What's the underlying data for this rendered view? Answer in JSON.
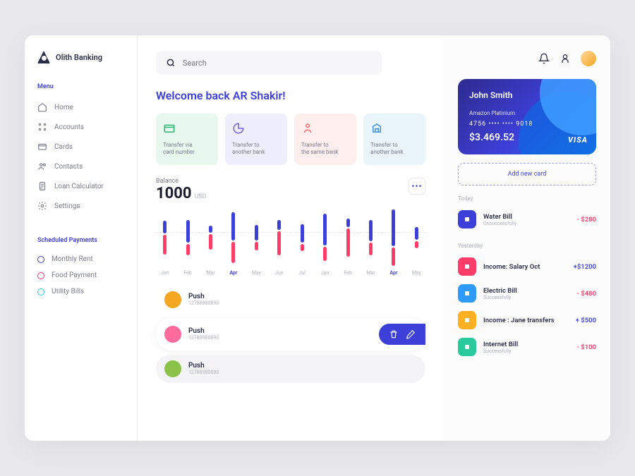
{
  "logo": {
    "text": "Olith Banking"
  },
  "sidebar": {
    "menu_title": "Menu",
    "items": [
      {
        "label": "Home"
      },
      {
        "label": "Accounts"
      },
      {
        "label": "Cards"
      },
      {
        "label": "Contacts"
      },
      {
        "label": "Loan Calculator"
      },
      {
        "label": "Settings"
      }
    ],
    "scheduled_title": "Scheduled Payments",
    "scheduled": [
      {
        "label": "Monthly Rent",
        "color": "#3d3fd9"
      },
      {
        "label": "Food Payment",
        "color": "#ff3d68"
      },
      {
        "label": "Utility Bills",
        "color": "#2fd0e6"
      }
    ]
  },
  "search": {
    "placeholder": "Search"
  },
  "welcome": "Welcome back AR Shakir!",
  "actions": [
    {
      "label": "Transfer via\ncard number",
      "bg": "#e8f8ee",
      "icon": "#2bb673"
    },
    {
      "label": "Transfer to\nanother bank",
      "bg": "#efeefc",
      "icon": "#6b5fe0"
    },
    {
      "label": "Transfer to\nthe same bank",
      "bg": "#feefee",
      "icon": "#ff6b6b"
    },
    {
      "label": "Transfer to\nanother bank",
      "bg": "#e9f5fb",
      "icon": "#3d8fe0"
    }
  ],
  "balance": {
    "label": "Balance",
    "value": "1000",
    "currency": "USD"
  },
  "chart_data": {
    "type": "bar",
    "categories": [
      "Jan",
      "Feb",
      "Mar",
      "Apr",
      "May",
      "Jun",
      "Jul",
      "Jan",
      "Feb",
      "Mar",
      "Apr",
      "May"
    ],
    "active_index": [
      3,
      10
    ],
    "series": [
      {
        "name": "blue",
        "color": "#3d3fd9",
        "values": [
          18,
          32,
          10,
          40,
          22,
          14,
          26,
          45,
          12,
          30,
          52,
          18
        ]
      },
      {
        "name": "red",
        "color": "#ff3d68",
        "values": [
          28,
          16,
          22,
          30,
          12,
          34,
          10,
          20,
          40,
          18,
          26,
          10
        ]
      }
    ]
  },
  "push": [
    {
      "name": "Push",
      "sub": "12788980890",
      "actions": false
    },
    {
      "name": "Push",
      "sub": "12788980890",
      "actions": true
    },
    {
      "name": "Push",
      "sub": "12788980890",
      "actions": false,
      "dark": true
    }
  ],
  "card": {
    "name": "John Smith",
    "plan": "Amazon Platinium",
    "number": "4756   ••••   ••••   9018",
    "balance": "$3.469.52",
    "brand": "VISA"
  },
  "add_card": "Add new card",
  "transactions": {
    "groups": [
      {
        "label": "Today",
        "items": [
          {
            "title": "Water Bill",
            "status": "Unsuccessfully",
            "amount": "- $280",
            "cls": "neg",
            "bg": "#3d3fd9"
          }
        ]
      },
      {
        "label": "Yesterday",
        "items": [
          {
            "title": "Income: Salary Oct",
            "status": "",
            "amount": "+$1200",
            "cls": "pos",
            "bg": "#ff3d68"
          },
          {
            "title": "Electric Bill",
            "status": "Successfully",
            "amount": "- $480",
            "cls": "neg",
            "bg": "#2f9bff"
          },
          {
            "title": "Income : Jane transfers",
            "status": "",
            "amount": "+ $500",
            "cls": "pos",
            "bg": "#ffb020"
          },
          {
            "title": "Internet Bill",
            "status": "Successfully",
            "amount": "- $100",
            "cls": "neg",
            "bg": "#28c99b"
          }
        ]
      }
    ]
  }
}
